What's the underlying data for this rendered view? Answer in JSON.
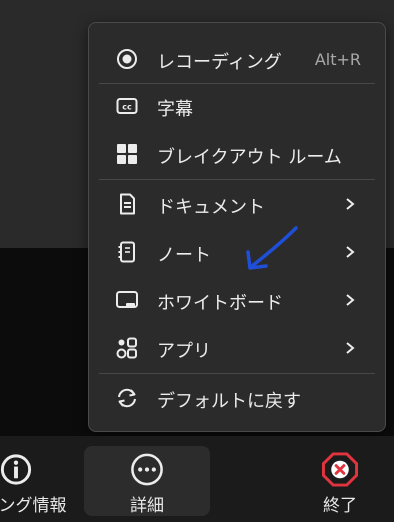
{
  "menu": {
    "items": [
      {
        "label": "レコーディング",
        "shortcut": "Alt+R",
        "icon": "record-icon"
      },
      {
        "label": "字幕",
        "icon": "closed-captions-icon"
      },
      {
        "label": "ブレイクアウト ルーム",
        "icon": "breakout-rooms-icon"
      },
      {
        "label": "ドキュメント",
        "icon": "document-icon",
        "has_submenu": true
      },
      {
        "label": "ノート",
        "icon": "notebook-icon",
        "has_submenu": true
      },
      {
        "label": "ホワイトボード",
        "icon": "whiteboard-icon",
        "has_submenu": true
      },
      {
        "label": "アプリ",
        "icon": "apps-icon",
        "has_submenu": true
      },
      {
        "label": "デフォルトに戻す",
        "icon": "reset-icon"
      }
    ]
  },
  "toolbar": {
    "info_label": "ティング情報",
    "more_label": "詳細",
    "end_label": "終了"
  },
  "colors": {
    "menu_bg": "#2b2b2b",
    "end_red": "#e2343f",
    "annotation_blue": "#1f4fd8"
  }
}
